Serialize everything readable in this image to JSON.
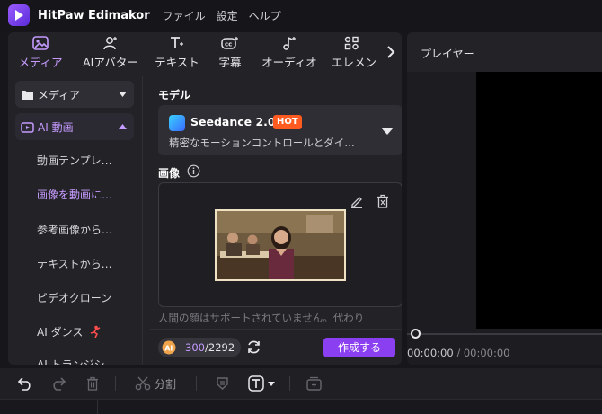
{
  "app": {
    "title": "HitPaw Edimakor",
    "menu": [
      "ファイル",
      "設定",
      "ヘルプ"
    ]
  },
  "tabs": [
    {
      "label": "メディア",
      "icon": "media-icon",
      "active": true
    },
    {
      "label": "AIアバター",
      "icon": "ai-avatar-icon",
      "active": false
    },
    {
      "label": "テキスト",
      "icon": "text-icon",
      "active": false
    },
    {
      "label": "字幕",
      "icon": "subtitle-icon",
      "active": false
    },
    {
      "label": "オーディオ",
      "icon": "audio-icon",
      "active": false
    },
    {
      "label": "エレメン",
      "icon": "elements-icon",
      "active": false
    }
  ],
  "sidebar": {
    "media_label": "メディア",
    "ai_video_label": "AI 動画",
    "items": [
      "動画テンプレ…",
      "画像を動画に…",
      "参考画像から…",
      "テキストから…",
      "ビデオクローン",
      "AI ダンス",
      "AI トランジシ…"
    ],
    "active_index": 1
  },
  "content": {
    "model_label": "モデル",
    "model_name": "Seedance 2.0",
    "model_badge": "HOT",
    "model_desc": "精密なモーションコントロールとダイ…",
    "image_label": "画像",
    "note": "人間の顔はサポートされていません。代わり"
  },
  "footer": {
    "credits_used": "300",
    "credits_total": "/2292",
    "create_label": "作成する"
  },
  "player": {
    "title": "プレイヤー",
    "time_current": "00:00:00",
    "time_separator": "/",
    "time_total": "00:00:00"
  },
  "toolbar": {
    "split_label": "分割"
  },
  "colors": {
    "accent": "#c69bff",
    "create_button": "#8a3ff0",
    "hot_badge": "#ff5a1f"
  }
}
